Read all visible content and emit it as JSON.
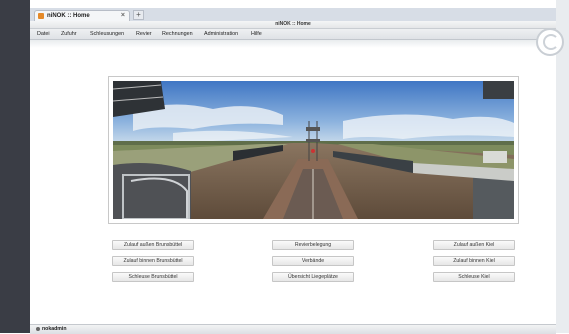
{
  "browser": {
    "tab_title": "niNOK :: Home",
    "tab_close": "×",
    "new_tab": "+"
  },
  "window": {
    "title": "niNOK :: Home"
  },
  "menu": {
    "items": [
      "Datei",
      "Zufuhr",
      "Schleusungen",
      "Revier",
      "Rechnungen",
      "Administration",
      "Hilfe"
    ]
  },
  "buttons": {
    "left": [
      "Zulauf außen Brunsbüttel",
      "Zulauf binnen Brunsbüttel",
      "Schleuse Brunsbüttel"
    ],
    "middle": [
      "Revierbelegung",
      "Verbände",
      "Übersicht Liegeplätze"
    ],
    "right": [
      "Zulauf außen Kiel",
      "Zulauf binnen Kiel",
      "Schleuse Kiel"
    ]
  },
  "status": {
    "user": "nokadmin"
  },
  "colors": {
    "sky": "#7da6d6",
    "water": "#7f6a55",
    "menubar": "#e4e7ea",
    "desktop": "#3a3d45"
  }
}
